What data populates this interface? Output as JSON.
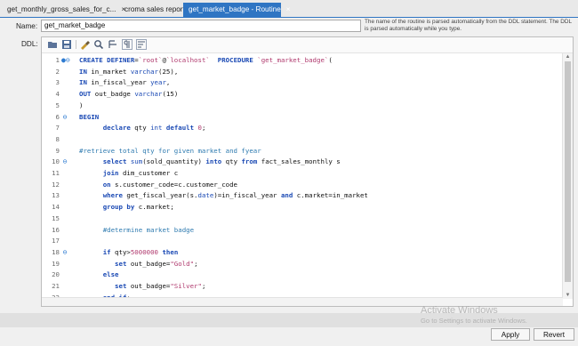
{
  "tabs": [
    {
      "label": "get_monthly_gross_sales_for_c...",
      "close": "×"
    },
    {
      "label": "croma sales report",
      "close": "×"
    },
    {
      "label": "get_market_badge - Routine",
      "close": "×"
    }
  ],
  "form": {
    "name_label": "Name:",
    "name_value": "get_market_badge",
    "hint": "The name of the routine is parsed automatically from the DDL statement. The DDL is parsed automatically while you type.",
    "ddl_label": "DDL:"
  },
  "toolbar_icons": [
    "folder-open-icon",
    "save-icon",
    "beautify-brush-icon",
    "find-icon",
    "word-wrap-icon",
    "invisible-chars-icon",
    "wrap-lines-icon"
  ],
  "code_lines": [
    {
      "n": "1",
      "fold": "●⊖",
      "segs": [
        [
          "kw",
          "CREATE DEFINER"
        ],
        [
          "",
          "="
        ],
        [
          "str",
          "`root`"
        ],
        [
          "",
          "@"
        ],
        [
          "str",
          "`localhost`"
        ],
        [
          "",
          "  "
        ],
        [
          "kw",
          "PROCEDURE"
        ],
        [
          "",
          " "
        ],
        [
          "str",
          "`get_market_badge`"
        ],
        [
          "",
          "("
        ]
      ]
    },
    {
      "n": "2",
      "fold": "",
      "segs": [
        [
          "kw",
          "IN"
        ],
        [
          "",
          " in_market "
        ],
        [
          "ty",
          "varchar"
        ],
        [
          "",
          "(25),"
        ]
      ]
    },
    {
      "n": "3",
      "fold": "",
      "segs": [
        [
          "kw",
          "IN"
        ],
        [
          "",
          " in_fiscal_year "
        ],
        [
          "ty",
          "year"
        ],
        [
          "",
          ","
        ]
      ]
    },
    {
      "n": "4",
      "fold": "",
      "segs": [
        [
          "kw",
          "OUT"
        ],
        [
          "",
          " out_badge "
        ],
        [
          "ty",
          "varchar"
        ],
        [
          "",
          "(15)"
        ]
      ]
    },
    {
      "n": "5",
      "fold": "",
      "segs": [
        [
          "",
          ")"
        ]
      ]
    },
    {
      "n": "6",
      "fold": "⊖",
      "segs": [
        [
          "kw",
          "BEGIN"
        ]
      ]
    },
    {
      "n": "7",
      "fold": "",
      "segs": [
        [
          "",
          "      "
        ],
        [
          "kw",
          "declare"
        ],
        [
          "",
          " qty "
        ],
        [
          "ty",
          "int"
        ],
        [
          "",
          " "
        ],
        [
          "kw",
          "default"
        ],
        [
          "",
          " "
        ],
        [
          "num",
          "0"
        ],
        [
          "",
          ";"
        ]
      ]
    },
    {
      "n": "8",
      "fold": "",
      "segs": [
        [
          "",
          ""
        ]
      ]
    },
    {
      "n": "9",
      "fold": "",
      "segs": [
        [
          "cm",
          "#retrieve total qty for given market and fyear"
        ]
      ]
    },
    {
      "n": "10",
      "fold": "⊖",
      "segs": [
        [
          "",
          "      "
        ],
        [
          "kw",
          "select"
        ],
        [
          "",
          " "
        ],
        [
          "ty",
          "sum"
        ],
        [
          "",
          "(sold_quantity) "
        ],
        [
          "kw",
          "into"
        ],
        [
          "",
          " qty "
        ],
        [
          "kw",
          "from"
        ],
        [
          "",
          " fact_sales_monthly s"
        ]
      ]
    },
    {
      "n": "11",
      "fold": "",
      "segs": [
        [
          "",
          "      "
        ],
        [
          "kw",
          "join"
        ],
        [
          "",
          " dim_customer c"
        ]
      ]
    },
    {
      "n": "12",
      "fold": "",
      "segs": [
        [
          "",
          "      "
        ],
        [
          "kw",
          "on"
        ],
        [
          "",
          " s.customer_code=c.customer_code"
        ]
      ]
    },
    {
      "n": "13",
      "fold": "",
      "segs": [
        [
          "",
          "      "
        ],
        [
          "kw",
          "where"
        ],
        [
          "",
          " get_fiscal_year(s."
        ],
        [
          "ty",
          "date"
        ],
        [
          "",
          ")=in_fiscal_year "
        ],
        [
          "kw",
          "and"
        ],
        [
          "",
          " c.market=in_market"
        ]
      ]
    },
    {
      "n": "14",
      "fold": "",
      "segs": [
        [
          "",
          "      "
        ],
        [
          "kw",
          "group by"
        ],
        [
          "",
          " c.market;"
        ]
      ]
    },
    {
      "n": "15",
      "fold": "",
      "segs": [
        [
          "",
          ""
        ]
      ]
    },
    {
      "n": "16",
      "fold": "",
      "segs": [
        [
          "",
          "      "
        ],
        [
          "cm",
          "#determine market badge"
        ]
      ]
    },
    {
      "n": "17",
      "fold": "",
      "segs": [
        [
          "",
          ""
        ]
      ]
    },
    {
      "n": "18",
      "fold": "⊖",
      "segs": [
        [
          "",
          "      "
        ],
        [
          "kw",
          "if"
        ],
        [
          "",
          " qty>"
        ],
        [
          "num",
          "5000000"
        ],
        [
          "",
          " "
        ],
        [
          "kw",
          "then"
        ]
      ]
    },
    {
      "n": "19",
      "fold": "",
      "segs": [
        [
          "",
          "         "
        ],
        [
          "kw",
          "set"
        ],
        [
          "",
          " out_badge="
        ],
        [
          "str",
          "\"Gold\""
        ],
        [
          "",
          ";"
        ]
      ]
    },
    {
      "n": "20",
      "fold": "",
      "segs": [
        [
          "",
          "      "
        ],
        [
          "kw",
          "else"
        ]
      ]
    },
    {
      "n": "21",
      "fold": "",
      "segs": [
        [
          "",
          "         "
        ],
        [
          "kw",
          "set"
        ],
        [
          "",
          " out_badge="
        ],
        [
          "str",
          "\"Silver\""
        ],
        [
          "",
          ";"
        ]
      ]
    },
    {
      "n": "22",
      "fold": "",
      "segs": [
        [
          "",
          "      "
        ],
        [
          "kw",
          "end if"
        ],
        [
          "",
          ";"
        ]
      ]
    }
  ],
  "buttons": {
    "apply": "Apply",
    "revert": "Revert"
  },
  "watermark": {
    "line1": "Activate Windows",
    "line2": "Go to Settings to activate Windows."
  },
  "colors": {
    "tab_active": "#2f75c3",
    "keyword": "#1a49b4",
    "string": "#b03a6e",
    "comment": "#2f7bb0"
  }
}
